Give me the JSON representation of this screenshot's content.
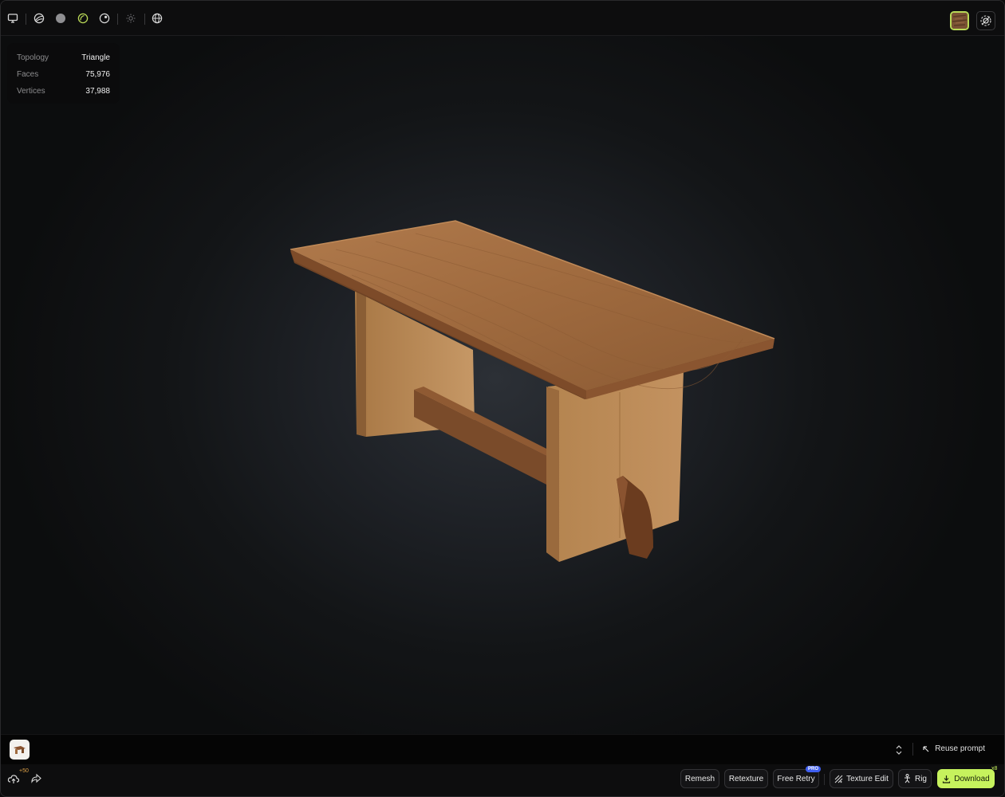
{
  "toolbar": {
    "icons": [
      "monitor-icon",
      "wireframe-sphere-icon",
      "solid-sphere-icon",
      "outline-sphere-icon",
      "material-sphere-icon",
      "light-icon",
      "environment-globe-icon"
    ],
    "texture_swatch_color": "#7a5234",
    "settings_icon": "view-settings-icon"
  },
  "stats": {
    "topology_label": "Topology",
    "topology_value": "Triangle",
    "faces_label": "Faces",
    "faces_value": "75,976",
    "vertices_label": "Vertices",
    "vertices_value": "37,988"
  },
  "prompt": {
    "reuse_label": "Reuse prompt"
  },
  "bottom": {
    "credits_badge": "+50",
    "remesh_label": "Remesh",
    "retexture_label": "Retexture",
    "free_retry_label": "Free Retry",
    "pro_badge": "PRO",
    "texture_edit_label": "Texture Edit",
    "rig_label": "Rig",
    "download_label": "Download",
    "download_badge": "x8"
  },
  "colors": {
    "accent": "#c6f25d",
    "pro_badge": "#3f5ff0",
    "active_icon": "#b9d957"
  }
}
